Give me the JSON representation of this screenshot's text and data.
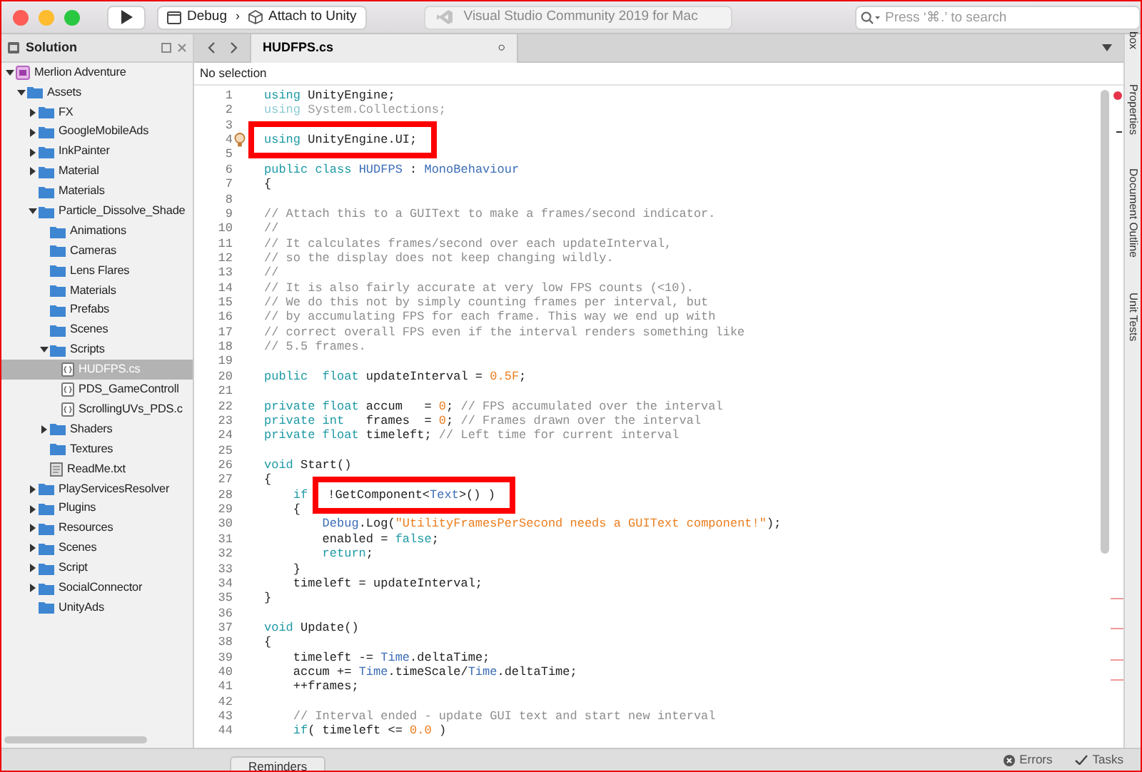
{
  "window": {
    "title": "Visual Studio Community 2019 for Mac"
  },
  "toolbar": {
    "configuration": "Debug",
    "separator": "›",
    "target": "Attach to Unity",
    "search": {
      "placeholder": "Press ‘⌘.’ to search"
    }
  },
  "solution_pad": {
    "title": "Solution",
    "tree": [
      {
        "label": "Merlion Adventure",
        "kind": "solution",
        "expanded": true,
        "selected": false,
        "children": [
          {
            "label": "Assets",
            "kind": "folder",
            "expanded": true,
            "selected": false,
            "children": [
              {
                "label": "FX",
                "kind": "folder",
                "expanded": false,
                "selected": false
              },
              {
                "label": "GoogleMobileAds",
                "kind": "folder",
                "expanded": false,
                "selected": false
              },
              {
                "label": "InkPainter",
                "kind": "folder",
                "expanded": false,
                "selected": false
              },
              {
                "label": "Material",
                "kind": "folder",
                "expanded": false,
                "selected": false
              },
              {
                "label": "Materials",
                "kind": "folder",
                "selected": false
              },
              {
                "label": "Particle_Dissolve_Shade",
                "kind": "folder",
                "expanded": true,
                "selected": false,
                "children": [
                  {
                    "label": "Animations",
                    "kind": "folder",
                    "selected": false
                  },
                  {
                    "label": "Cameras",
                    "kind": "folder",
                    "selected": false
                  },
                  {
                    "label": "Lens Flares",
                    "kind": "folder",
                    "selected": false
                  },
                  {
                    "label": "Materials",
                    "kind": "folder",
                    "selected": false
                  },
                  {
                    "label": "Prefabs",
                    "kind": "folder",
                    "selected": false
                  },
                  {
                    "label": "Scenes",
                    "kind": "folder",
                    "selected": false
                  },
                  {
                    "label": "Scripts",
                    "kind": "folder",
                    "expanded": true,
                    "selected": false,
                    "children": [
                      {
                        "label": "HUDFPS.cs",
                        "kind": "code",
                        "selected": true
                      },
                      {
                        "label": "PDS_GameControll",
                        "kind": "code",
                        "selected": false
                      },
                      {
                        "label": "ScrollingUVs_PDS.c",
                        "kind": "code",
                        "selected": false
                      }
                    ]
                  },
                  {
                    "label": "Shaders",
                    "kind": "folder",
                    "expanded": false,
                    "selected": false
                  },
                  {
                    "label": "Textures",
                    "kind": "folder",
                    "selected": false
                  },
                  {
                    "label": "ReadMe.txt",
                    "kind": "text",
                    "selected": false
                  }
                ]
              },
              {
                "label": "PlayServicesResolver",
                "kind": "folder",
                "expanded": false,
                "selected": false
              },
              {
                "label": "Plugins",
                "kind": "folder",
                "expanded": false,
                "selected": false
              },
              {
                "label": "Resources",
                "kind": "folder",
                "expanded": false,
                "selected": false
              },
              {
                "label": "Scenes",
                "kind": "folder",
                "expanded": false,
                "selected": false
              },
              {
                "label": "Script",
                "kind": "folder",
                "expanded": false,
                "selected": false
              },
              {
                "label": "SocialConnector",
                "kind": "folder",
                "expanded": false,
                "selected": false
              },
              {
                "label": "UnityAds",
                "kind": "folder",
                "selected": false
              }
            ]
          }
        ]
      }
    ]
  },
  "editor": {
    "tabs": [
      {
        "label": "HUDFPS.cs",
        "selected": true,
        "close": "○"
      }
    ],
    "breadcrumb": "No selection",
    "lines": [
      {
        "number": "1",
        "tokens": [
          {
            "kind": "kw",
            "text": "using"
          },
          {
            "kind": "p",
            "text": " UnityEngine;"
          }
        ]
      },
      {
        "number": "2",
        "tokens": [
          {
            "kind": "fkw",
            "text": "using"
          },
          {
            "kind": "fp",
            "text": " System.Collections;"
          }
        ]
      },
      {
        "number": "3"
      },
      {
        "number": "4",
        "bulb": true,
        "boxed": [
          {
            "kind": "kw",
            "text": "using"
          },
          {
            "kind": "p",
            "text": " UnityEngine.UI;"
          }
        ]
      },
      {
        "number": "5"
      },
      {
        "number": "6",
        "tokens": [
          {
            "kind": "kw",
            "text": "public class "
          },
          {
            "kind": "type",
            "text": "HUDFPS"
          },
          {
            "kind": "p",
            "text": " : "
          },
          {
            "kind": "type",
            "text": "MonoBehaviour"
          }
        ]
      },
      {
        "number": "7",
        "tokens": [
          {
            "kind": "p",
            "text": "{"
          }
        ]
      },
      {
        "number": "8"
      },
      {
        "number": "9",
        "tokens": [
          {
            "kind": "cm",
            "text": "// Attach this to a GUIText to make a frames/second indicator."
          }
        ]
      },
      {
        "number": "10",
        "tokens": [
          {
            "kind": "cm",
            "text": "//"
          }
        ]
      },
      {
        "number": "11",
        "tokens": [
          {
            "kind": "cm",
            "text": "// It calculates frames/second over each updateInterval,"
          }
        ]
      },
      {
        "number": "12",
        "tokens": [
          {
            "kind": "cm",
            "text": "// so the display does not keep changing wildly."
          }
        ]
      },
      {
        "number": "13",
        "tokens": [
          {
            "kind": "cm",
            "text": "//"
          }
        ]
      },
      {
        "number": "14",
        "tokens": [
          {
            "kind": "cm",
            "text": "// It is also fairly accurate at very low FPS counts (<10)."
          }
        ]
      },
      {
        "number": "15",
        "tokens": [
          {
            "kind": "cm",
            "text": "// We do this not by simply counting frames per interval, but"
          }
        ]
      },
      {
        "number": "16",
        "tokens": [
          {
            "kind": "cm",
            "text": "// by accumulating FPS for each frame. This way we end up with"
          }
        ]
      },
      {
        "number": "17",
        "tokens": [
          {
            "kind": "cm",
            "text": "// correct overall FPS even if the interval renders something like"
          }
        ]
      },
      {
        "number": "18",
        "tokens": [
          {
            "kind": "cm",
            "text": "// 5.5 frames."
          }
        ]
      },
      {
        "number": "19"
      },
      {
        "number": "20",
        "tokens": [
          {
            "kind": "kw",
            "text": "public  float"
          },
          {
            "kind": "p",
            "text": " updateInterval = "
          },
          {
            "kind": "num",
            "text": "0.5F"
          },
          {
            "kind": "p",
            "text": ";"
          }
        ]
      },
      {
        "number": "21"
      },
      {
        "number": "22",
        "tokens": [
          {
            "kind": "kw",
            "text": "private float"
          },
          {
            "kind": "p",
            "text": " accum   = "
          },
          {
            "kind": "num",
            "text": "0"
          },
          {
            "kind": "p",
            "text": "; "
          },
          {
            "kind": "cm",
            "text": "// FPS accumulated over the interval"
          }
        ]
      },
      {
        "number": "23",
        "tokens": [
          {
            "kind": "kw",
            "text": "private int"
          },
          {
            "kind": "p",
            "text": "   frames  = "
          },
          {
            "kind": "num",
            "text": "0"
          },
          {
            "kind": "p",
            "text": "; "
          },
          {
            "kind": "cm",
            "text": "// Frames drawn over the interval"
          }
        ]
      },
      {
        "number": "24",
        "tokens": [
          {
            "kind": "kw",
            "text": "private float"
          },
          {
            "kind": "p",
            "text": " timeleft; "
          },
          {
            "kind": "cm",
            "text": "// Left time for current interval"
          }
        ]
      },
      {
        "number": "25"
      },
      {
        "number": "26",
        "tokens": [
          {
            "kind": "kw",
            "text": "void"
          },
          {
            "kind": "p",
            "text": " Start()"
          }
        ]
      },
      {
        "number": "27",
        "tokens": [
          {
            "kind": "p",
            "text": "{"
          }
        ]
      },
      {
        "number": "28",
        "tokens": [
          {
            "kind": "kw",
            "text": "    if"
          }
        ],
        "boxed": [
          {
            "kind": "p",
            "text": "!GetComponent<"
          },
          {
            "kind": "type",
            "text": "Text"
          },
          {
            "kind": "p",
            "text": ">() )"
          }
        ]
      },
      {
        "number": "29",
        "tokens": [
          {
            "kind": "p",
            "text": "    {"
          }
        ]
      },
      {
        "number": "30",
        "tokens": [
          {
            "kind": "type",
            "text": "        Debug"
          },
          {
            "kind": "p",
            "text": ".Log("
          },
          {
            "kind": "str",
            "text": "\"UtilityFramesPerSecond needs a GUIText component!\""
          },
          {
            "kind": "p",
            "text": ");"
          }
        ]
      },
      {
        "number": "31",
        "tokens": [
          {
            "kind": "p",
            "text": "        enabled = "
          },
          {
            "kind": "kw",
            "text": "false"
          },
          {
            "kind": "p",
            "text": ";"
          }
        ]
      },
      {
        "number": "32",
        "tokens": [
          {
            "kind": "kw",
            "text": "        return"
          },
          {
            "kind": "p",
            "text": ";"
          }
        ]
      },
      {
        "number": "33",
        "tokens": [
          {
            "kind": "p",
            "text": "    }"
          }
        ]
      },
      {
        "number": "34",
        "tokens": [
          {
            "kind": "p",
            "text": "    timeleft = updateInterval;"
          }
        ]
      },
      {
        "number": "35",
        "tokens": [
          {
            "kind": "p",
            "text": "}"
          }
        ]
      },
      {
        "number": "36"
      },
      {
        "number": "37",
        "tokens": [
          {
            "kind": "kw",
            "text": "void"
          },
          {
            "kind": "p",
            "text": " Update()"
          }
        ]
      },
      {
        "number": "38",
        "tokens": [
          {
            "kind": "p",
            "text": "{"
          }
        ]
      },
      {
        "number": "39",
        "tokens": [
          {
            "kind": "p",
            "text": "    timeleft -= "
          },
          {
            "kind": "type",
            "text": "Time"
          },
          {
            "kind": "p",
            "text": ".deltaTime;"
          }
        ]
      },
      {
        "number": "40",
        "tokens": [
          {
            "kind": "p",
            "text": "    accum += "
          },
          {
            "kind": "type",
            "text": "Time"
          },
          {
            "kind": "p",
            "text": ".timeScale/"
          },
          {
            "kind": "type",
            "text": "Time"
          },
          {
            "kind": "p",
            "text": ".deltaTime;"
          }
        ]
      },
      {
        "number": "41",
        "tokens": [
          {
            "kind": "p",
            "text": "    ++frames;"
          }
        ]
      },
      {
        "number": "42"
      },
      {
        "number": "43",
        "tokens": [
          {
            "kind": "cm",
            "text": "    // Interval ended - update GUI text and start new interval"
          }
        ]
      },
      {
        "number": "44",
        "tokens": [
          {
            "kind": "kw",
            "text": "    if"
          },
          {
            "kind": "p",
            "text": "( timeleft <= "
          },
          {
            "kind": "num",
            "text": "0.0"
          },
          {
            "kind": "p",
            "text": " )"
          }
        ]
      }
    ]
  },
  "side_tabs": [
    "box",
    "Properties",
    "Document Outline",
    "Unit Tests"
  ],
  "bottom_bar": {
    "tabs": [
      "Reminders"
    ],
    "errors": "Errors",
    "tasks": "Tasks"
  }
}
